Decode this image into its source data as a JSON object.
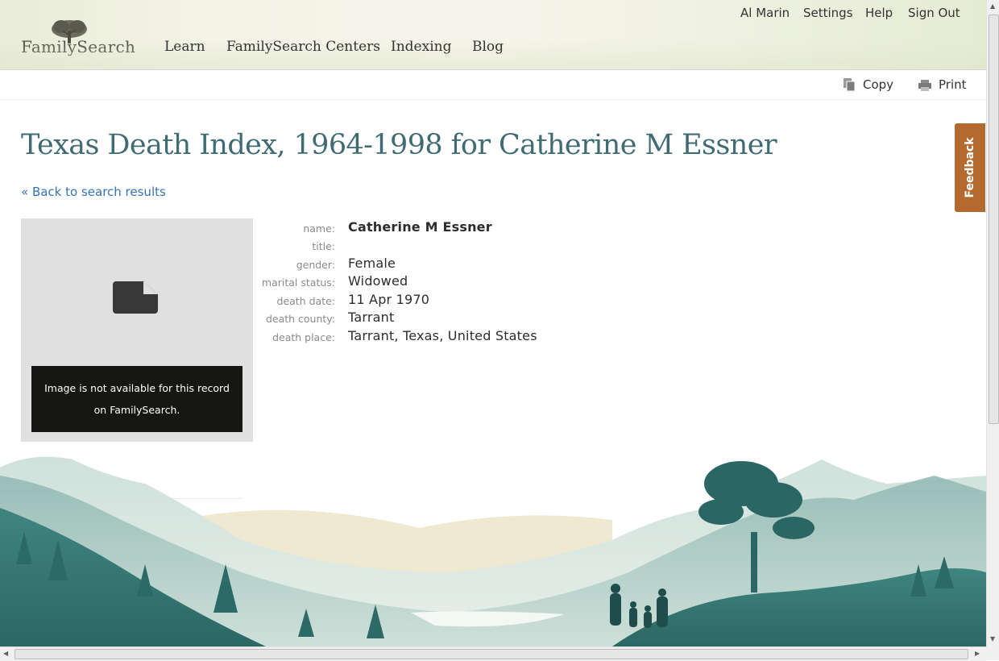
{
  "brand": {
    "logo_text": "FamilySearch"
  },
  "nav": {
    "items": [
      "Learn",
      "FamilySearch Centers",
      "Indexing",
      "Blog"
    ]
  },
  "userbar": {
    "user_name": "Al Marin",
    "settings": "Settings",
    "help": "Help",
    "sign_out": "Sign Out"
  },
  "toolbar": {
    "copy": "Copy",
    "print": "Print"
  },
  "page": {
    "title": "Texas Death Index, 1964-1998 for Catherine M Essner",
    "back_link": "« Back to search results"
  },
  "image_panel": {
    "message": "Image is not available for this record on FamilySearch."
  },
  "record": {
    "fields": [
      {
        "label": "name:",
        "value": "Catherine M Essner"
      },
      {
        "label": "title:",
        "value": ""
      },
      {
        "label": "gender:",
        "value": "Female"
      },
      {
        "label": "marital status:",
        "value": "Widowed"
      },
      {
        "label": "death date:",
        "value": "11 Apr 1970"
      },
      {
        "label": "death county:",
        "value": "Tarrant"
      },
      {
        "label": "death place:",
        "value": "Tarrant, Texas, United States"
      }
    ]
  },
  "feedback": {
    "label": "Feedback"
  },
  "colors": {
    "title": "#3f6b72",
    "link": "#3474b5",
    "feedback": "#b4692e",
    "landscape_dark": "#2f6f6b"
  }
}
